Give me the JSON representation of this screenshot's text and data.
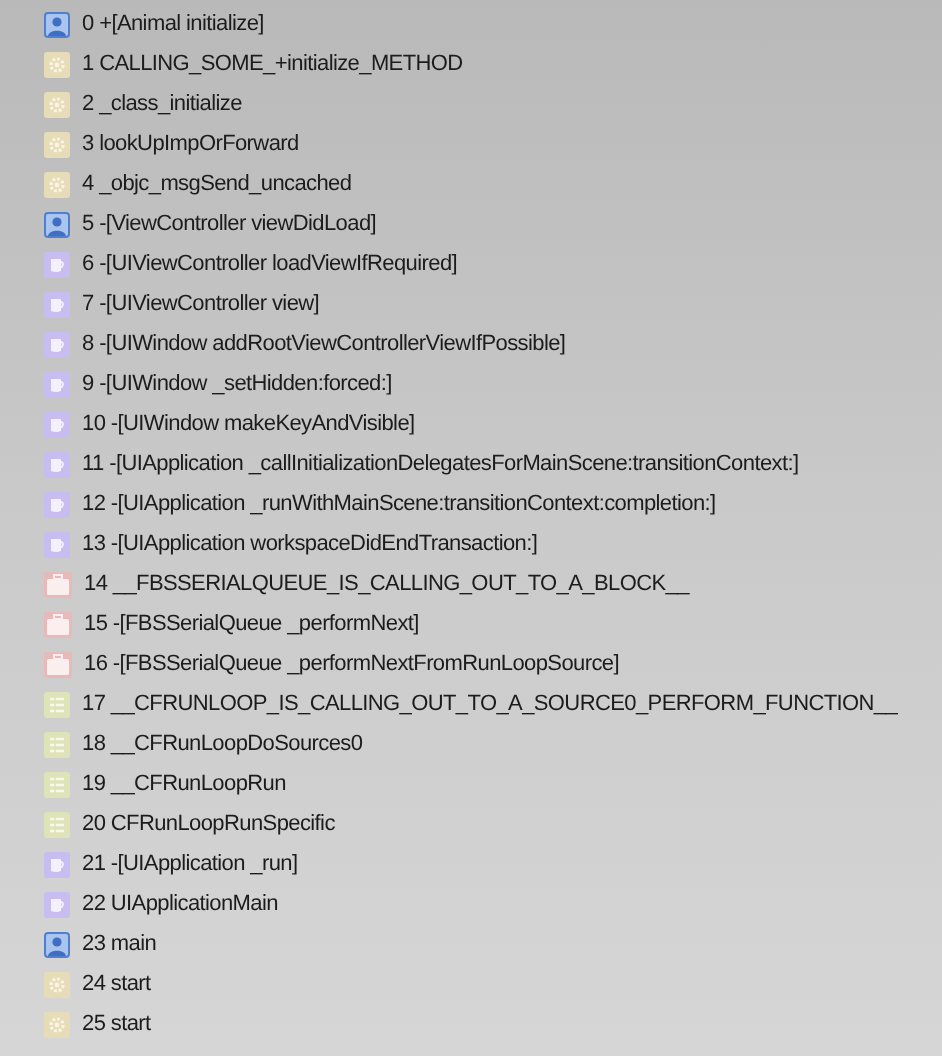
{
  "frames": [
    {
      "kind": "user",
      "label": "0 +[Animal initialize]"
    },
    {
      "kind": "system",
      "label": "1 CALLING_SOME_+initialize_METHOD"
    },
    {
      "kind": "system",
      "label": "2 _class_initialize"
    },
    {
      "kind": "system",
      "label": "3 lookUpImpOrForward"
    },
    {
      "kind": "system",
      "label": "4 _objc_msgSend_uncached"
    },
    {
      "kind": "user",
      "label": "5 -[ViewController viewDidLoad]"
    },
    {
      "kind": "uikit",
      "label": "6 -[UIViewController loadViewIfRequired]"
    },
    {
      "kind": "uikit",
      "label": "7 -[UIViewController view]"
    },
    {
      "kind": "uikit",
      "label": "8 -[UIWindow addRootViewControllerViewIfPossible]"
    },
    {
      "kind": "uikit",
      "label": "9 -[UIWindow _setHidden:forced:]"
    },
    {
      "kind": "uikit",
      "label": "10 -[UIWindow makeKeyAndVisible]"
    },
    {
      "kind": "uikit",
      "label": "11 -[UIApplication _callInitializationDelegatesForMainScene:transitionContext:]"
    },
    {
      "kind": "uikit",
      "label": "12 -[UIApplication _runWithMainScene:transitionContext:completion:]"
    },
    {
      "kind": "uikit",
      "label": "13 -[UIApplication workspaceDidEndTransaction:]"
    },
    {
      "kind": "frontboard",
      "label": "14 __FBSSERIALQUEUE_IS_CALLING_OUT_TO_A_BLOCK__"
    },
    {
      "kind": "frontboard",
      "label": "15 -[FBSSerialQueue _performNext]"
    },
    {
      "kind": "frontboard",
      "label": "16 -[FBSSerialQueue _performNextFromRunLoopSource]"
    },
    {
      "kind": "corefoundation",
      "label": "17 __CFRUNLOOP_IS_CALLING_OUT_TO_A_SOURCE0_PERFORM_FUNCTION__"
    },
    {
      "kind": "corefoundation",
      "label": "18 __CFRunLoopDoSources0"
    },
    {
      "kind": "corefoundation",
      "label": "19 __CFRunLoopRun"
    },
    {
      "kind": "corefoundation",
      "label": "20 CFRunLoopRunSpecific"
    },
    {
      "kind": "uikit",
      "label": "21 -[UIApplication _run]"
    },
    {
      "kind": "uikit",
      "label": "22 UIApplicationMain"
    },
    {
      "kind": "user",
      "label": "23 main"
    },
    {
      "kind": "system",
      "label": "24 start"
    },
    {
      "kind": "system",
      "label": "25 start"
    }
  ]
}
